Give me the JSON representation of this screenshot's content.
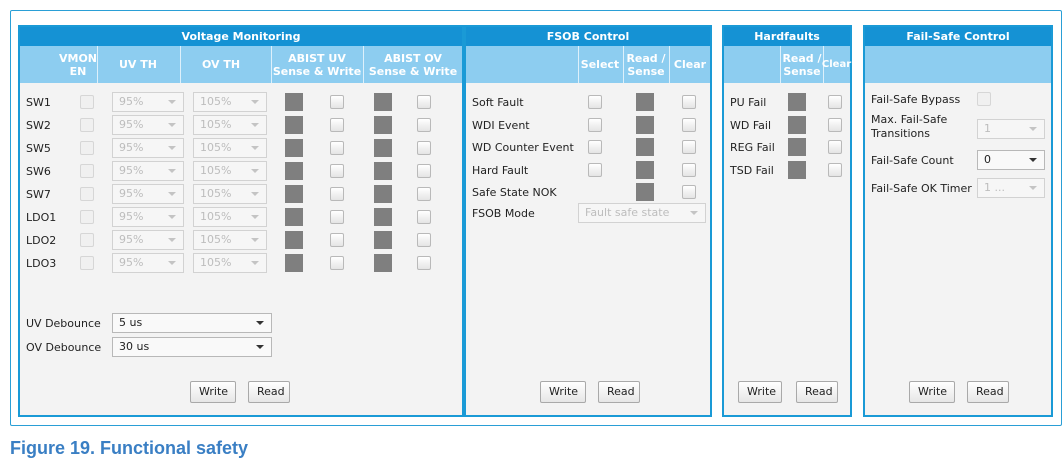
{
  "voltage_monitoring": {
    "title": "Voltage Monitoring",
    "headers": {
      "vmon_en": "VMON EN",
      "uv_th": "UV TH",
      "ov_th": "OV TH",
      "abist_uv": "ABIST UV Sense & Write",
      "abist_ov": "ABIST OV Sense & Write"
    },
    "rows": [
      {
        "label": "SW1",
        "uv": "95%",
        "ov": "105%"
      },
      {
        "label": "SW2",
        "uv": "95%",
        "ov": "105%"
      },
      {
        "label": "SW5",
        "uv": "95%",
        "ov": "105%"
      },
      {
        "label": "SW6",
        "uv": "95%",
        "ov": "105%"
      },
      {
        "label": "SW7",
        "uv": "95%",
        "ov": "105%"
      },
      {
        "label": "LDO1",
        "uv": "95%",
        "ov": "105%"
      },
      {
        "label": "LDO2",
        "uv": "95%",
        "ov": "105%"
      },
      {
        "label": "LDO3",
        "uv": "95%",
        "ov": "105%"
      }
    ],
    "uv_debounce": {
      "label": "UV Debounce",
      "value": "5 us"
    },
    "ov_debounce": {
      "label": "OV Debounce",
      "value": "30 us"
    },
    "write_label": "Write",
    "read_label": "Read"
  },
  "fsob_control": {
    "title": "FSOB Control",
    "headers": {
      "select": "Select",
      "read_sense": "Read / Sense",
      "clear": "Clear"
    },
    "rows": [
      {
        "label": "Soft Fault"
      },
      {
        "label": "WDI Event"
      },
      {
        "label": "WD Counter Event"
      },
      {
        "label": "Hard Fault"
      },
      {
        "label": "Safe State NOK"
      }
    ],
    "fsob_mode": {
      "label": "FSOB Mode",
      "value": "Fault safe state"
    },
    "write_label": "Write",
    "read_label": "Read"
  },
  "hardfaults": {
    "title": "Hardfaults",
    "headers": {
      "read_sense": "Read / Sense",
      "clear": "Clear"
    },
    "rows": [
      {
        "label": "PU Fail"
      },
      {
        "label": "WD Fail"
      },
      {
        "label": "REG Fail"
      },
      {
        "label": "TSD Fail"
      }
    ],
    "write_label": "Write",
    "read_label": "Read"
  },
  "fail_safe_control": {
    "title": "Fail-Safe Control",
    "bypass_label": "Fail-Safe Bypass",
    "max_transitions": {
      "label": "Max. Fail-Safe Transitions",
      "value": "1"
    },
    "count": {
      "label": "Fail-Safe Count",
      "value": "0"
    },
    "ok_timer": {
      "label": "Fail-Safe OK Timer",
      "value": "1 ..."
    },
    "write_label": "Write",
    "read_label": "Read"
  },
  "caption": "Figure 19.  Functional safety",
  "colors": {
    "accent": "#1592d4",
    "header_light": "#8dcdf0",
    "indicator": "#7f7f7f"
  }
}
